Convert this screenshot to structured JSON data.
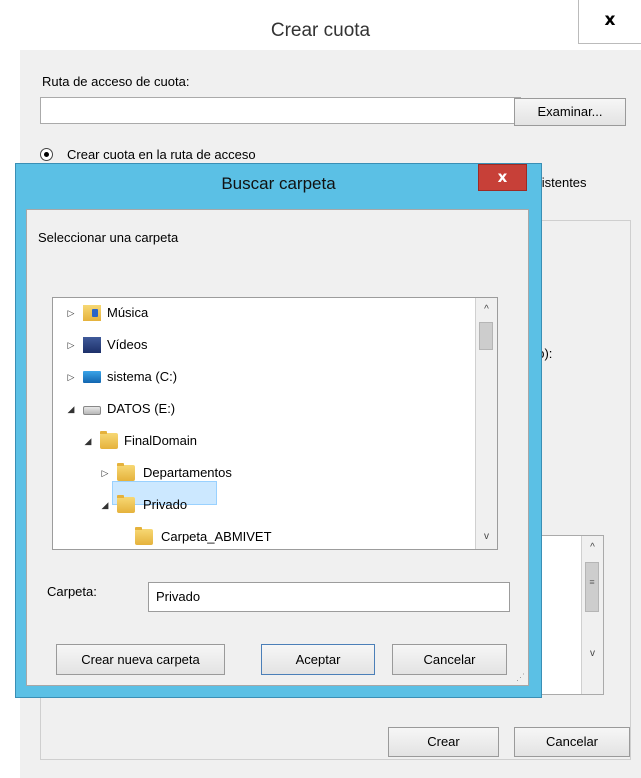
{
  "parent_dialog": {
    "title": "Crear cuota",
    "close_label": "x",
    "path_label": "Ruta de acceso de cuota:",
    "path_value": "",
    "browse_label": "Examinar...",
    "radio_option_label": "Crear cuota en la ruta de acceso",
    "radio_option2_fragment": "existentes",
    "partial_label": "do):",
    "create_label": "Crear",
    "cancel_label": "Cancelar"
  },
  "browse_dialog": {
    "title": "Buscar carpeta",
    "close_label": "x",
    "instruction": "Seleccionar una carpeta",
    "tree": [
      {
        "label": "Música",
        "icon": "music-folder-icon",
        "expander": "▷",
        "level": 0
      },
      {
        "label": "Vídeos",
        "icon": "videos-folder-icon",
        "expander": "▷",
        "level": 0
      },
      {
        "label": "sistema (C:)",
        "icon": "system-drive-icon",
        "expander": "▷",
        "level": 0
      },
      {
        "label": "DATOS (E:)",
        "icon": "drive-icon",
        "expander": "◢",
        "level": 0
      },
      {
        "label": "FinalDomain",
        "icon": "folder-icon",
        "expander": "◢",
        "level": 1
      },
      {
        "label": "Departamentos",
        "icon": "folder-icon",
        "expander": "▷",
        "level": 2
      },
      {
        "label": "Privado",
        "icon": "folder-icon",
        "expander": "◢",
        "level": 2,
        "selected": true
      },
      {
        "label": "Carpeta_ABMIVET",
        "icon": "folder-icon",
        "expander": "",
        "level": 3
      }
    ],
    "folder_label": "Carpeta:",
    "folder_value": "Privado",
    "new_folder_label": "Crear nueva carpeta",
    "ok_label": "Aceptar",
    "cancel_label": "Cancelar"
  }
}
